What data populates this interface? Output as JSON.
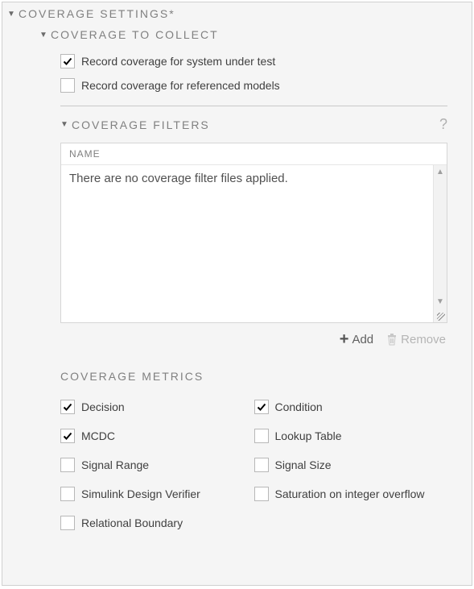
{
  "header": {
    "title": "COVERAGE SETTINGS*"
  },
  "collect": {
    "title": "COVERAGE TO COLLECT",
    "sut": {
      "label": "Record coverage for system under test",
      "checked": true
    },
    "ref": {
      "label": "Record coverage for referenced models",
      "checked": false
    }
  },
  "filters": {
    "title": "COVERAGE FILTERS",
    "column": "NAME",
    "empty": "There are no coverage filter files applied.",
    "add": "Add",
    "remove": "Remove"
  },
  "metrics": {
    "title": "COVERAGE METRICS",
    "items": [
      {
        "label": "Decision",
        "checked": true
      },
      {
        "label": "Condition",
        "checked": true
      },
      {
        "label": "MCDC",
        "checked": true
      },
      {
        "label": "Lookup Table",
        "checked": false
      },
      {
        "label": "Signal Range",
        "checked": false
      },
      {
        "label": "Signal Size",
        "checked": false
      },
      {
        "label": "Simulink Design Verifier",
        "checked": false
      },
      {
        "label": "Saturation on integer overflow",
        "checked": false
      },
      {
        "label": "Relational Boundary",
        "checked": false
      }
    ]
  }
}
